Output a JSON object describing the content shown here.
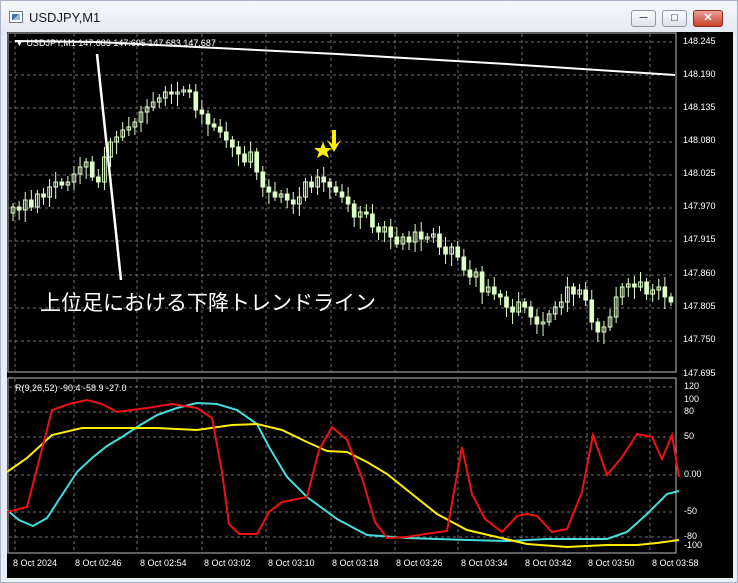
{
  "window": {
    "title": "USDJPY,M1",
    "buttons": [
      "minimize-icon",
      "maximize-icon",
      "close-icon"
    ]
  },
  "chart": {
    "ohlc_header": "USDJPY,M1  147.683 147.695 147.683 147.687",
    "price_ticks": [
      "148.245",
      "148.190",
      "148.135",
      "148.080",
      "148.025",
      "147.970",
      "147.915",
      "147.860",
      "147.805",
      "147.750",
      "147.695"
    ],
    "time_ticks": [
      "8 Oct 2024",
      "8 Oct 02:46",
      "8 Oct 02:54",
      "8 Oct 03:02",
      "8 Oct 03:10",
      "8 Oct 03:18",
      "8 Oct 03:26",
      "8 Oct 03:34",
      "8 Oct 03:42",
      "8 Oct 03:50",
      "8 Oct 03:58"
    ],
    "annotation": "上位足における下降トレンドライン",
    "colors": {
      "background": "#000000",
      "grid": "#6f6f6f",
      "bull_candle": "#dfffc8",
      "trendline": "#ffffff",
      "signal_arrow": "#ffee00",
      "indicator_red": "#ee1111",
      "indicator_cyan": "#44dddd",
      "indicator_yellow": "#ffee00"
    }
  },
  "indicator": {
    "header": "R(9,26,52) -90.4 -58.9 -27.0",
    "ticks": [
      "120",
      "100",
      "80",
      "50",
      "0.00",
      "-50",
      "-80",
      "-100"
    ]
  }
}
